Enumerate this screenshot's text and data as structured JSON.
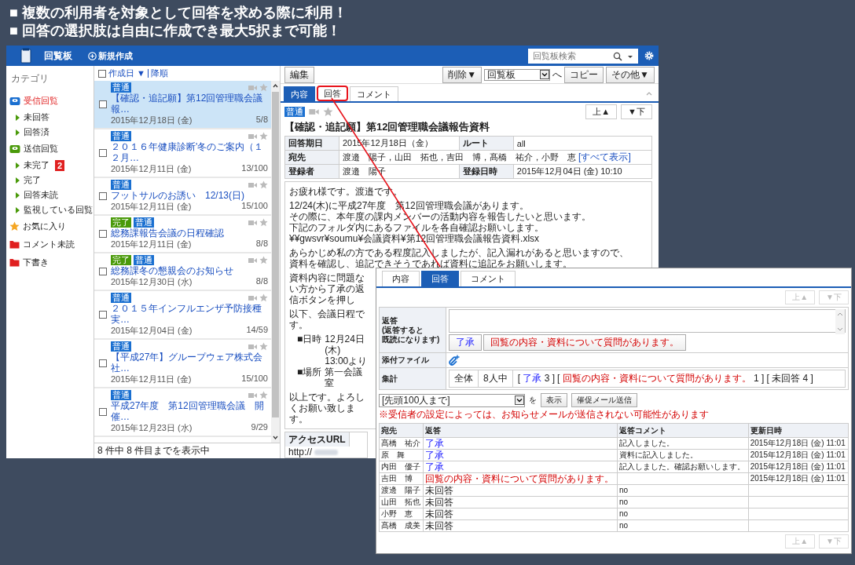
{
  "headline": [
    "■ 複数の利用者を対象として回答を求める際に利用！",
    "■ 回答の選択肢は自由に作成でき最大5択まで可能！"
  ],
  "app": {
    "title": "回覧板",
    "new_button": "新規作成",
    "search": {
      "placeholder": "回覧板検索"
    }
  },
  "sidebar": {
    "heading": "カテゴリ",
    "items": [
      {
        "label": "受信回覧",
        "kind": "inbox",
        "selected": true,
        "children": [
          {
            "label": "未回答",
            "selected": false
          },
          {
            "label": "回答済",
            "selected": false
          }
        ]
      },
      {
        "label": "送信回覧",
        "kind": "outbox",
        "selected": false,
        "children": [
          {
            "label": "未完了",
            "badge": "2",
            "selected": false
          },
          {
            "label": "完了",
            "selected": false
          },
          {
            "label": "回答未読",
            "selected": false
          },
          {
            "label": "監視している回覧",
            "selected": false
          }
        ]
      },
      {
        "label": "お気に入り",
        "kind": "favorite",
        "selected": false
      },
      {
        "label": "コメント未読",
        "kind": "folder",
        "selected": false
      },
      {
        "label": "下書き",
        "kind": "folder",
        "selected": false
      }
    ]
  },
  "list": {
    "all_checked": false,
    "sort": "作成日",
    "sort_arrow": "▼",
    "order": "降順",
    "items": [
      {
        "tags": [
          {
            "label": "普通",
            "color": "#1a6fd0"
          }
        ],
        "title": "【確認・追記願】第12回管理職会議報…",
        "date": "2015年12月18日 (金)",
        "count": "5/8",
        "selected": true,
        "checked": false
      },
      {
        "tags": [
          {
            "label": "普通",
            "color": "#1a6fd0"
          }
        ],
        "title": "２０１６年健康診断'冬のご案内（１２月…",
        "date": "2015年12月11日 (金)",
        "count": "13/100",
        "selected": false,
        "checked": false
      },
      {
        "tags": [
          {
            "label": "普通",
            "color": "#1a6fd0"
          }
        ],
        "title": "フットサルのお誘い　12/13(日)",
        "date": "2015年12月11日 (金)",
        "count": "15/100",
        "selected": false,
        "checked": false
      },
      {
        "tags": [
          {
            "label": "完了",
            "color": "#4a9a0a"
          },
          {
            "label": "普通",
            "color": "#1a6fd0"
          }
        ],
        "title": "総務課報告会議の日程確認",
        "date": "2015年12月11日 (金)",
        "count": "8/8",
        "selected": false,
        "checked": false
      },
      {
        "tags": [
          {
            "label": "完了",
            "color": "#4a9a0a"
          },
          {
            "label": "普通",
            "color": "#1a6fd0"
          }
        ],
        "title": "総務課冬の懇親会のお知らせ",
        "date": "2015年12月30日 (水)",
        "count": "8/8",
        "selected": false,
        "checked": false
      },
      {
        "tags": [
          {
            "label": "普通",
            "color": "#1a6fd0"
          }
        ],
        "title": "２０１５年インフルエンザ予防接種実…",
        "date": "2015年12月04日 (金)",
        "count": "14/59",
        "selected": false,
        "checked": false
      },
      {
        "tags": [
          {
            "label": "普通",
            "color": "#1a6fd0"
          }
        ],
        "title": "【平成27年】グループウェア株式会社…",
        "date": "2015年12月11日 (金)",
        "count": "15/100",
        "selected": false,
        "checked": false
      },
      {
        "tags": [
          {
            "label": "普通",
            "color": "#1a6fd0"
          }
        ],
        "title": "平成27年度　第12回管理職会議　開催…",
        "date": "2015年12月23日 (水)",
        "count": "9/29",
        "selected": false,
        "checked": false
      }
    ],
    "footer": "8 件中 8 件目までを表示中"
  },
  "detail": {
    "toolbar": {
      "edit": "編集",
      "delete": "削除▼",
      "folder": "回覧板",
      "move": "へ",
      "copy": "コピー",
      "other": "その他▼"
    },
    "tabs": [
      {
        "label": "内容",
        "selected": true,
        "highlighted": false
      },
      {
        "label": "回答",
        "selected": false,
        "highlighted": true
      },
      {
        "label": "コメント",
        "selected": false,
        "highlighted": false
      }
    ],
    "nav": [
      {
        "label": "上▲",
        "disabled": false
      },
      {
        "label": "▼下",
        "disabled": false
      }
    ],
    "tag": {
      "label": "普通",
      "color": "#1a6fd0"
    },
    "title": "【確認・追記願】第12回管理職会議報告資料",
    "info": [
      {
        "cells": [
          {
            "kind": "label",
            "text": "回答期日"
          },
          {
            "kind": "value",
            "text": "2015年12月18日（金）"
          },
          {
            "kind": "label",
            "text": "ルート"
          },
          {
            "kind": "value",
            "text": "all"
          }
        ]
      },
      {
        "cells": [
          {
            "kind": "label",
            "text": "宛先"
          },
          {
            "kind": "value",
            "text": "渡邉　陽子，山田　拓也，吉田　博，髙橋　祐介，小野　恵",
            "link": "[すべて表示]"
          }
        ]
      },
      {
        "cells": [
          {
            "kind": "label",
            "text": "登録者"
          },
          {
            "kind": "value",
            "text": "渡邉　陽子"
          },
          {
            "kind": "label",
            "text": "登録日時"
          },
          {
            "kind": "value",
            "text": "2015年12月04日 (金) 10:10"
          }
        ]
      }
    ],
    "body": [
      {
        "kind": "text",
        "lines": [
          "お疲れ様です。渡邉です。"
        ]
      },
      {
        "kind": "text",
        "lines": [
          "12/24(木)に平成27年度　第12回管理職会議があります。",
          "その際に、本年度の課内メンバーの活動内容を報告したいと思います。",
          "下記のフォルダ内にあるファイルを各自確認お願いします。",
          "¥¥gwsvr¥soumu¥会議資料¥第12回管理職会議報告資料.xlsx"
        ]
      },
      {
        "kind": "text",
        "lines": [
          "あらかじめ私の方である程度記入しましたが、記入漏れがあると思いますので、",
          "資料を確認し、追記できそうであれば資料に追記をお願いします。"
        ]
      },
      {
        "kind": "text",
        "lines": [
          "資料内容に問題ない方から了承の返信ボタンを押し"
        ]
      },
      {
        "kind": "text",
        "lines": [
          "以下、会議日程です。"
        ]
      },
      {
        "kind": "schedule",
        "rows": [
          {
            "label": "■日時",
            "value": "12月24日(木)　13:00より"
          },
          {
            "label": "■場所",
            "value": "第一会議室"
          }
        ]
      },
      {
        "kind": "text",
        "lines": [
          "以上です。よろしくお願い致します。"
        ]
      }
    ],
    "access": {
      "label": "アクセスURL",
      "value": "http://"
    }
  },
  "answer_panel": {
    "tabs": [
      {
        "label": "内容",
        "selected": false
      },
      {
        "label": "回答",
        "selected": true
      },
      {
        "label": "コメント",
        "selected": false
      }
    ],
    "nav_top": [
      {
        "label": "上▲",
        "disabled": true
      },
      {
        "label": "▼下",
        "disabled": true
      }
    ],
    "reply": {
      "label_lines": [
        "返答",
        "(返答すると",
        "既読になります)"
      ],
      "choices": [
        {
          "label": "了承",
          "kind": "ok"
        },
        {
          "label": "回覧の内容・資料について質問があります。",
          "kind": "question"
        }
      ]
    },
    "attachment": {
      "label": "添付ファイル"
    },
    "summary": {
      "label": "集計",
      "scope": "全体",
      "total": "8人中",
      "open": "[",
      "close": "]",
      "tallies": [
        {
          "label": "了承",
          "count": "3",
          "kind": "ok"
        },
        {
          "label": "回覧の内容・資料について質問があります。",
          "count": "1",
          "kind": "question"
        },
        {
          "label": "未回答",
          "count": "4",
          "kind": "none"
        }
      ]
    },
    "range_select": {
      "value": "[先頭100人まで]"
    },
    "particle": "を",
    "show_button": "表示",
    "remind_button": "催促メール送信",
    "note": "※受信者の設定によっては、お知らせメールが送信されない可能性があります",
    "table": {
      "columns": [
        "宛先",
        "返答",
        "返答コメント",
        "更新日時"
      ],
      "rows": [
        {
          "name": "髙橋　祐介",
          "reply": "了承",
          "kind": "ok",
          "comment": "記入しました。",
          "updated": "2015年12月18日 (金) 11:01"
        },
        {
          "name": "原　舞",
          "reply": "了承",
          "kind": "ok",
          "comment": "資料に記入しました。",
          "updated": "2015年12月18日 (金) 11:01"
        },
        {
          "name": "内田　優子",
          "reply": "了承",
          "kind": "ok",
          "comment": "記入しました。確認お願いします。",
          "updated": "2015年12月18日 (金) 11:01"
        },
        {
          "name": "吉田　博",
          "reply": "回覧の内容・資料について質問があります。",
          "kind": "question",
          "updated": "2015年12月18日 (金) 11:01"
        },
        {
          "name": "渡邊　陽子",
          "reply": "未回答",
          "kind": "none",
          "comment": "no"
        },
        {
          "name": "山田　拓也",
          "reply": "未回答",
          "kind": "none",
          "comment": "no"
        },
        {
          "name": "小野　恵",
          "reply": "未回答",
          "kind": "none",
          "comment": "no"
        },
        {
          "name": "髙橋　成美",
          "reply": "未回答",
          "kind": "none",
          "comment": "no"
        }
      ]
    },
    "nav_bottom": [
      {
        "label": "上▲",
        "disabled": true
      },
      {
        "label": "▼下",
        "disabled": true
      }
    ]
  }
}
